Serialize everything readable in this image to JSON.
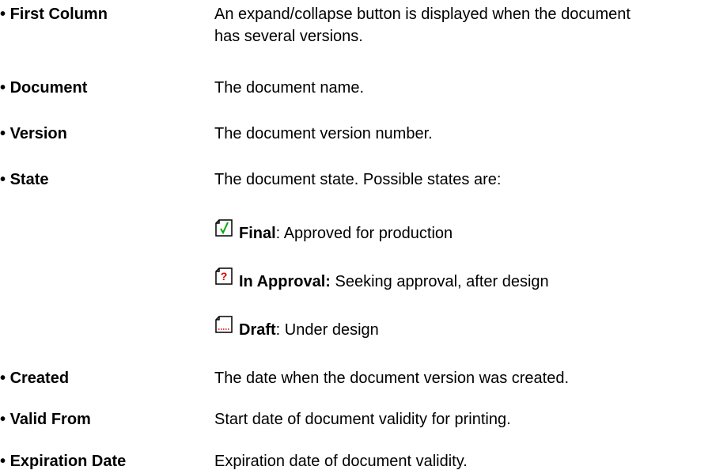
{
  "bullet": "•",
  "rows": {
    "first_column": {
      "term": "First Column",
      "desc_line1": "An expand/collapse button is displayed when the document",
      "desc_line2": "has several versions."
    },
    "document": {
      "term": "Document",
      "desc": "The document name."
    },
    "version": {
      "term": "Version",
      "desc": "The document version number."
    },
    "state": {
      "term": "State",
      "desc": "The document state. Possible states are:"
    },
    "created": {
      "term": "Created",
      "desc": "The date when the document version was created."
    },
    "valid_from": {
      "term": "Valid From",
      "desc": "Start date of document validity for printing."
    },
    "expiration_date": {
      "term": "Expiration Date",
      "desc": "Expiration date of document validity."
    }
  },
  "states": [
    {
      "name": "Final",
      "sep": ": ",
      "desc": "Approved for production",
      "icon": "final-check-icon",
      "color": "#00aa00"
    },
    {
      "name": "In Approval:",
      "sep": " ",
      "desc": "Seeking approval, after design",
      "icon": "approval-question-icon",
      "color": "#dd0000"
    },
    {
      "name": "Draft",
      "sep": ": ",
      "desc": "Under design",
      "icon": "draft-dotted-icon",
      "color": "#dd0000"
    }
  ]
}
